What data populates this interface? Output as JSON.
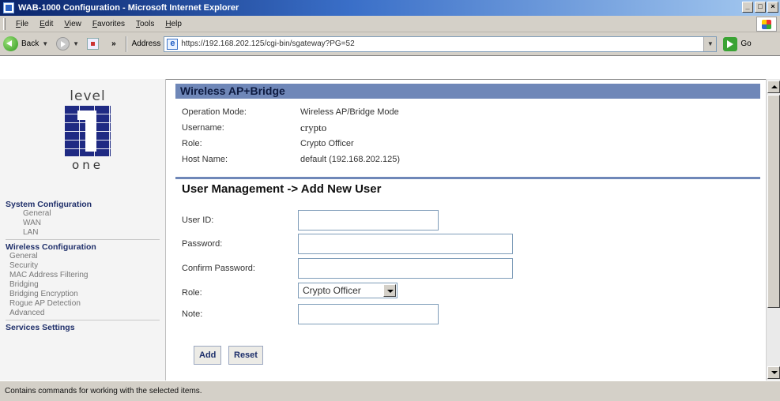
{
  "window": {
    "title": "WAB-1000 Configuration - Microsoft Internet Explorer",
    "controls": [
      "_",
      "□",
      "×"
    ]
  },
  "menubar": {
    "items": [
      "File",
      "Edit",
      "View",
      "Favorites",
      "Tools",
      "Help"
    ]
  },
  "toolbar": {
    "back_label": "Back",
    "more_chevron": "»",
    "address_label": "Address",
    "address_value": "https://192.168.202.125/cgi-bin/sgateway?PG=52",
    "go_label": "Go"
  },
  "sidebar": {
    "logo_word": "level",
    "logo_sub": "one",
    "sections": [
      {
        "title": "System Configuration",
        "items": [
          "General",
          "WAN",
          "LAN"
        ]
      },
      {
        "title": "Wireless Configuration",
        "items": [
          "General",
          "Security",
          "MAC Address Filtering",
          "Bridging",
          "Bridging Encryption",
          "Rogue AP Detection",
          "Advanced"
        ]
      },
      {
        "title": "Services Settings",
        "items": []
      }
    ]
  },
  "main": {
    "header": "Wireless AP+Bridge",
    "info": {
      "operation_mode_label": "Operation Mode:",
      "operation_mode_value": "Wireless AP/Bridge Mode",
      "username_label": "Username:",
      "username_value": "crypto",
      "role_label": "Role:",
      "role_value": "Crypto Officer",
      "hostname_label": "Host Name:",
      "hostname_value": "default (192.168.202.125)"
    },
    "section_title": "User Management -> Add New User",
    "form": {
      "userid_label": "User ID:",
      "userid_value": "",
      "password_label": "Password:",
      "password_value": "",
      "confirm_label": "Confirm Password:",
      "confirm_value": "",
      "role_label": "Role:",
      "role_selected": "Crypto Officer",
      "note_label": "Note:",
      "note_value": ""
    },
    "buttons": {
      "add": "Add",
      "reset": "Reset"
    }
  },
  "statusbar": {
    "text": "Contains commands for working with the selected items."
  },
  "colors": {
    "title_gradient_start": "#0a246a",
    "header_bar": "#6f87b8",
    "nav_section": "#1f2f6a",
    "logo_blue": "#1f2a83"
  }
}
